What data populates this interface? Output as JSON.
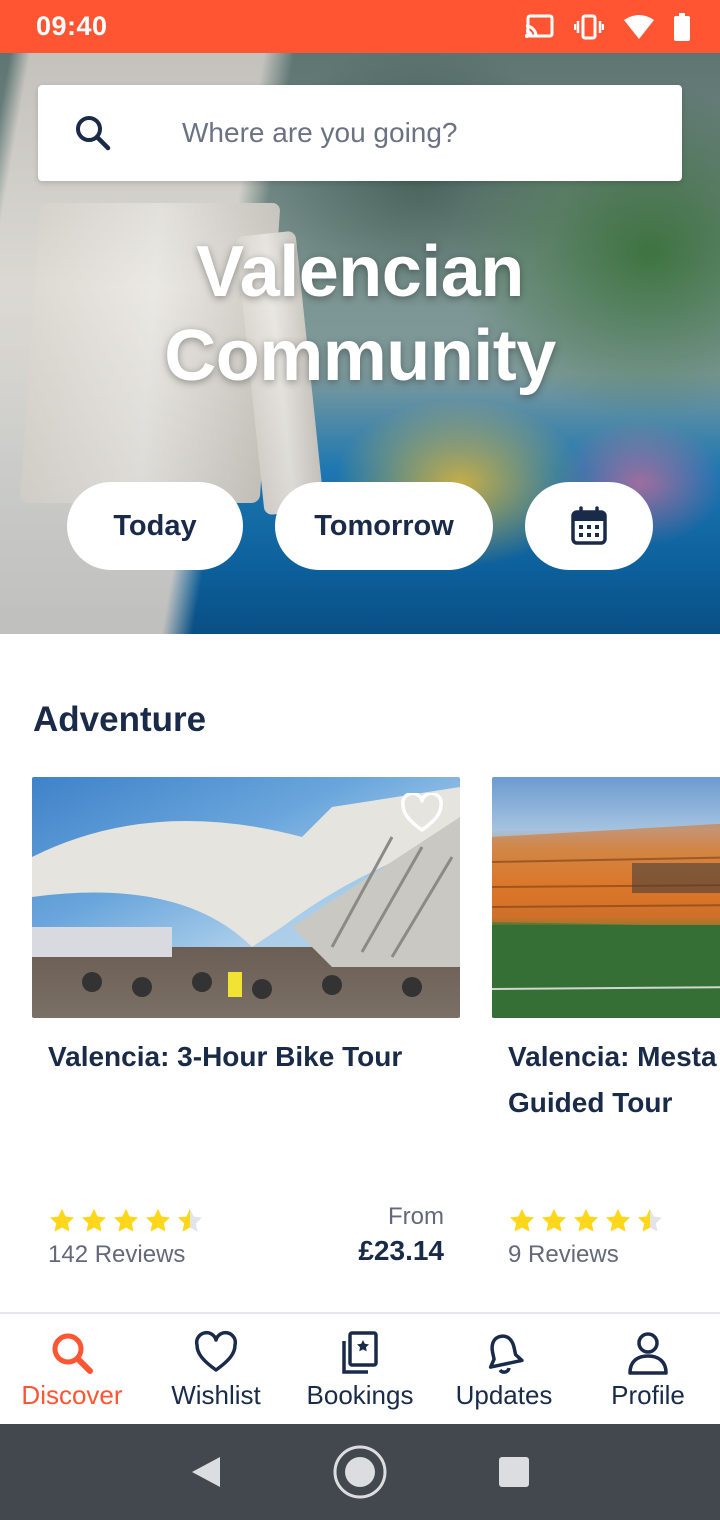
{
  "status_bar": {
    "time": "09:40"
  },
  "search": {
    "placeholder": "Where are you going?"
  },
  "hero": {
    "title": "Valencian Community",
    "date_buttons": {
      "today": "Today",
      "tomorrow": "Tomorrow",
      "calendar_icon": "calendar-icon"
    }
  },
  "section": {
    "title": "Adventure",
    "cards": [
      {
        "title": "Valencia: 3-Hour Bike Tour",
        "rating": 4.5,
        "reviews": "142 Reviews",
        "price_prefix": "From",
        "price": "£23.14"
      },
      {
        "title_line1": "Valencia: Mesta",
        "title_line2": "Guided Tour",
        "rating": 4.5,
        "reviews": "9 Reviews"
      }
    ]
  },
  "bottom_nav": {
    "items": [
      {
        "label": "Discover",
        "icon": "search-icon",
        "active": true
      },
      {
        "label": "Wishlist",
        "icon": "heart-icon"
      },
      {
        "label": "Bookings",
        "icon": "ticket-icon"
      },
      {
        "label": "Updates",
        "icon": "bell-icon"
      },
      {
        "label": "Profile",
        "icon": "person-icon"
      }
    ]
  },
  "colors": {
    "accent": "#ff5533",
    "text": "#1a2b49",
    "star": "#ffd71a"
  }
}
